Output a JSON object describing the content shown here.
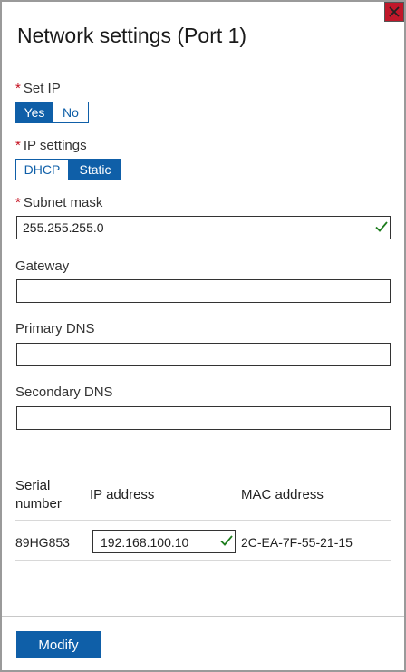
{
  "dialog": {
    "title": "Network settings (Port 1)",
    "close_icon": "close-icon"
  },
  "set_ip": {
    "label": "Set IP",
    "required": "*",
    "options": [
      "Yes",
      "No"
    ],
    "selected": "Yes"
  },
  "ip_settings": {
    "label": "IP settings",
    "required": "*",
    "options": [
      "DHCP",
      "Static"
    ],
    "selected": "Static"
  },
  "subnet_mask": {
    "label": "Subnet mask",
    "required": "*",
    "value": "255.255.255.0",
    "valid_icon": "checkmark-icon"
  },
  "gateway": {
    "label": "Gateway",
    "value": ""
  },
  "primary_dns": {
    "label": "Primary DNS",
    "value": ""
  },
  "secondary_dns": {
    "label": "Secondary DNS",
    "value": ""
  },
  "table": {
    "headers": {
      "serial": "Serial\nnumber",
      "ip": "IP address",
      "mac": "MAC address"
    },
    "row": {
      "serial": "89HG853",
      "ip": "192.168.100.10",
      "mac": "2C-EA-7F-55-21-15"
    }
  },
  "footer": {
    "modify_label": "Modify"
  },
  "colors": {
    "accent": "#0f5fa8",
    "required": "#c50f1f",
    "valid": "#1e7d1e",
    "close": "#c0182a"
  }
}
